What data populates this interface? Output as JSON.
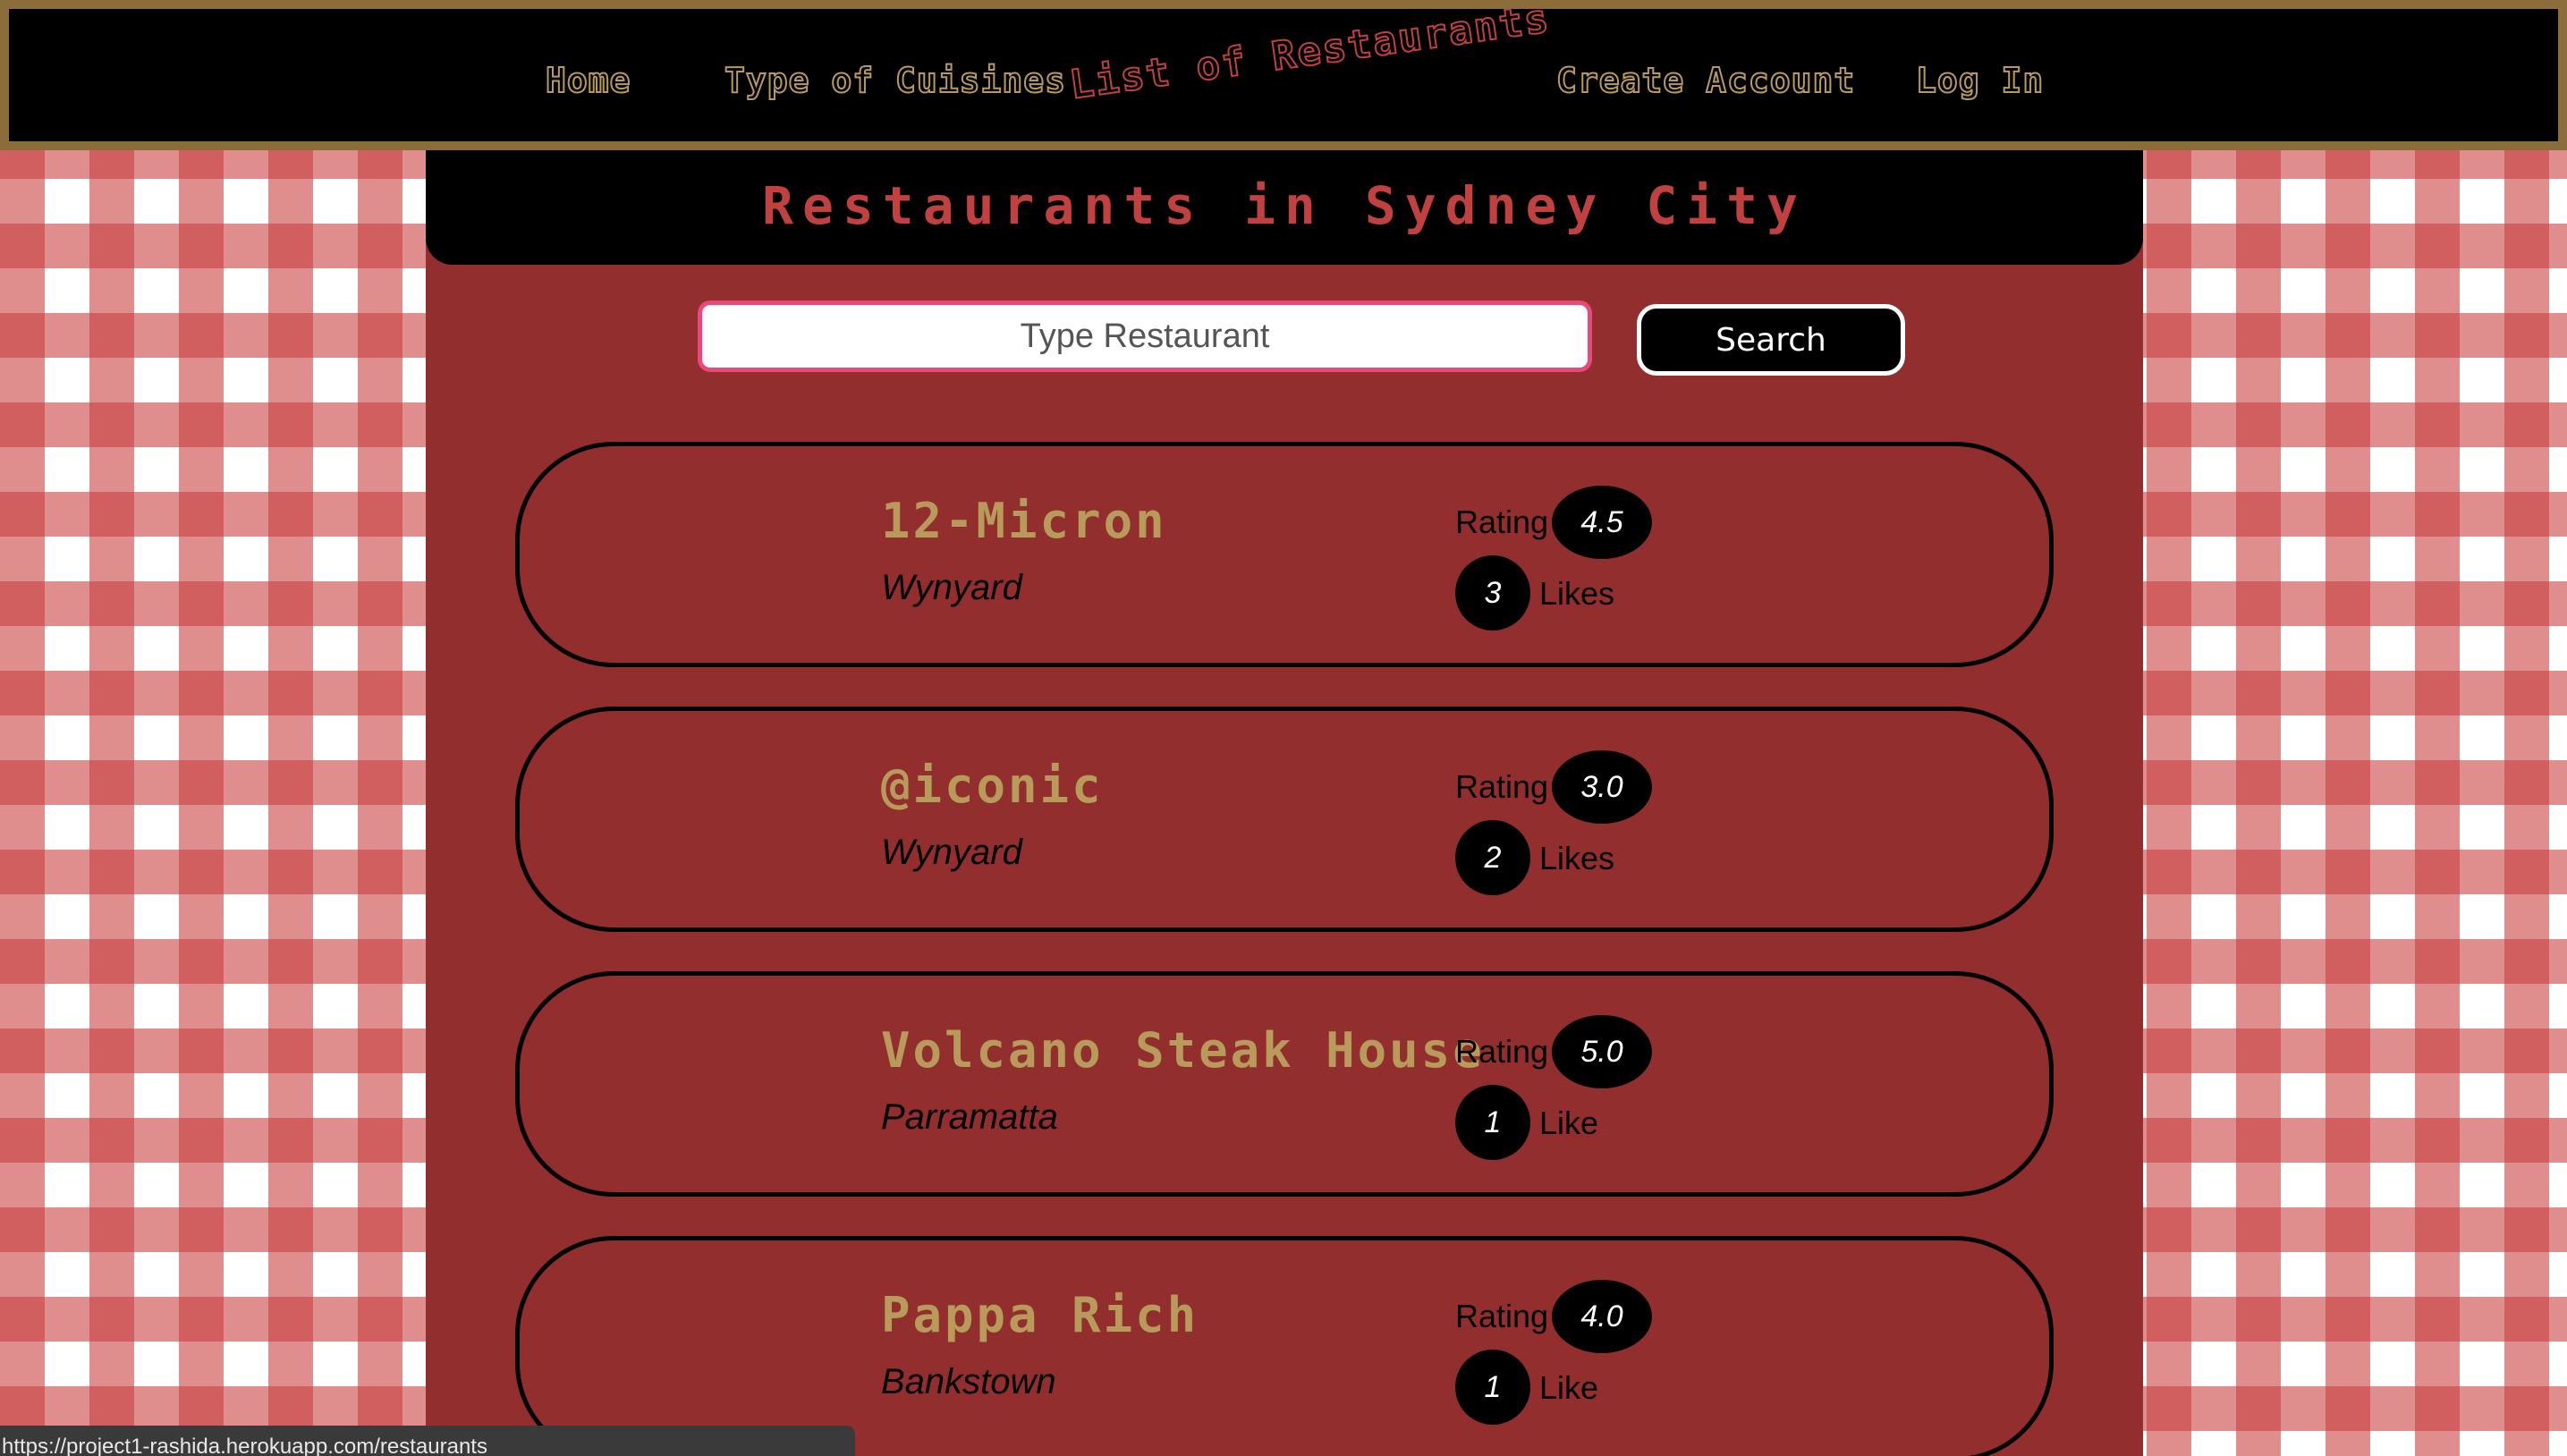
{
  "nav": {
    "home": "Home",
    "cuisines": "Type of Cuisines",
    "brand": "List of Restaurants",
    "create_account": "Create Account",
    "login": "Log In"
  },
  "page": {
    "title": "Restaurants in Sydney City"
  },
  "search": {
    "placeholder": "Type Restaurant",
    "button_label": "Search"
  },
  "restaurants": [
    {
      "name": "12-Micron",
      "suburb": "Wynyard",
      "rating_label": "Rating",
      "rating": "4.5",
      "likes": "3",
      "likes_label": "Likes"
    },
    {
      "name": "@iconic",
      "suburb": "Wynyard",
      "rating_label": "Rating",
      "rating": "3.0",
      "likes": "2",
      "likes_label": "Likes"
    },
    {
      "name": "Volcano Steak House",
      "suburb": "Parramatta",
      "rating_label": "Rating",
      "rating": "5.0",
      "likes": "1",
      "likes_label": "Like"
    },
    {
      "name": "Pappa Rich",
      "suburb": "Bankstown",
      "rating_label": "Rating",
      "rating": "4.0",
      "likes": "1",
      "likes_label": "Like"
    }
  ],
  "status_bar": {
    "url": "https://project1-rashida.herokuapp.com/restaurants"
  },
  "colors": {
    "nav_bg": "#000000",
    "nav_border": "#8a6d3b",
    "panel": "#922e2e",
    "accent_gold": "#b89a5a",
    "accent_red": "#c0413f",
    "search_border": "#e8487a",
    "tablecloth_red": "#ca4141"
  }
}
